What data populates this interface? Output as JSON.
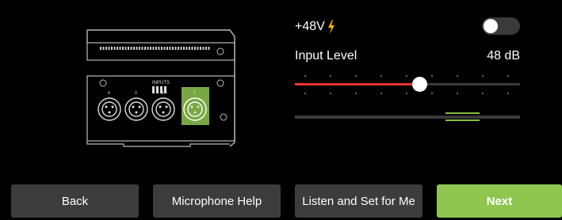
{
  "phantom": {
    "label": "+48V",
    "enabled": false
  },
  "input_level": {
    "label": "Input Level",
    "value": "48 dB",
    "slider_fraction": 0.6
  },
  "device": {
    "inputs_label": "INPUTS",
    "channel_numbers": [
      "4",
      "3",
      "2",
      "1"
    ],
    "selected_channel": "1"
  },
  "buttons": {
    "back": "Back",
    "mic_help": "Microphone Help",
    "listen": "Listen and Set for Me",
    "next": "Next"
  },
  "colors": {
    "accent_green": "#8ec64f",
    "slider_red": "#e8342e",
    "bolt": "#f5b400"
  },
  "icons": {
    "phantom": "lightning-bolt-icon"
  }
}
